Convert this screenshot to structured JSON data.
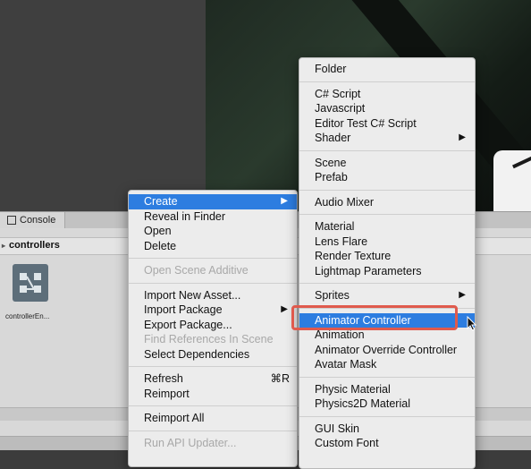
{
  "console_tab": {
    "label": "Console"
  },
  "breadcrumb": {
    "folder": "controllers"
  },
  "asset": {
    "label": "controllerEn..."
  },
  "main_menu": [
    {
      "label": "Create",
      "arrow": "▶",
      "highlight": true
    },
    {
      "label": "Reveal in Finder"
    },
    {
      "label": "Open"
    },
    {
      "label": "Delete"
    },
    {
      "sep": true
    },
    {
      "label": "Open Scene Additive",
      "disabled": true
    },
    {
      "sep": true
    },
    {
      "label": "Import New Asset..."
    },
    {
      "label": "Import Package",
      "arrow": "▶"
    },
    {
      "label": "Export Package..."
    },
    {
      "label": "Find References In Scene",
      "disabled": true
    },
    {
      "label": "Select Dependencies"
    },
    {
      "sep": true
    },
    {
      "label": "Refresh",
      "shortcut": "⌘R"
    },
    {
      "label": "Reimport"
    },
    {
      "sep": true
    },
    {
      "label": "Reimport All"
    },
    {
      "sep": true
    },
    {
      "label": "Run API Updater...",
      "disabled": true
    }
  ],
  "sub_menu": [
    {
      "label": "Folder"
    },
    {
      "sep": true
    },
    {
      "label": "C# Script"
    },
    {
      "label": "Javascript"
    },
    {
      "label": "Editor Test C# Script"
    },
    {
      "label": "Shader",
      "arrow": "▶"
    },
    {
      "sep": true
    },
    {
      "label": "Scene"
    },
    {
      "label": "Prefab"
    },
    {
      "sep": true
    },
    {
      "label": "Audio Mixer"
    },
    {
      "sep": true
    },
    {
      "label": "Material"
    },
    {
      "label": "Lens Flare"
    },
    {
      "label": "Render Texture"
    },
    {
      "label": "Lightmap Parameters"
    },
    {
      "sep": true
    },
    {
      "label": "Sprites",
      "arrow": "▶"
    },
    {
      "sep": true
    },
    {
      "label": "Animator Controller",
      "highlight": true
    },
    {
      "label": "Animation"
    },
    {
      "label": "Animator Override Controller"
    },
    {
      "label": "Avatar Mask"
    },
    {
      "sep": true
    },
    {
      "label": "Physic Material"
    },
    {
      "label": "Physics2D Material"
    },
    {
      "sep": true
    },
    {
      "label": "GUI Skin"
    },
    {
      "label": "Custom Font"
    }
  ]
}
